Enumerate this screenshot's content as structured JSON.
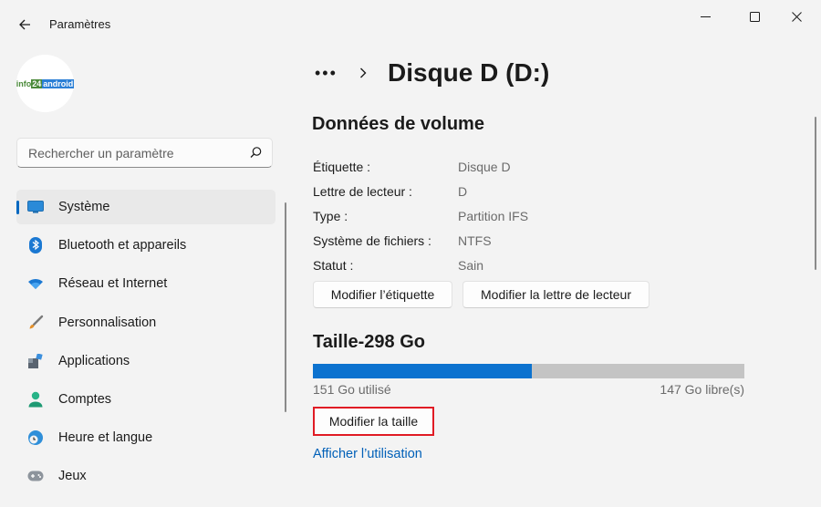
{
  "window": {
    "title": "Paramètres"
  },
  "logo": {
    "text": "info24android"
  },
  "search": {
    "placeholder": "Rechercher un paramètre"
  },
  "nav": {
    "items": [
      {
        "label": "Système",
        "icon": "monitor-icon",
        "selected": true
      },
      {
        "label": "Bluetooth et appareils",
        "icon": "bluetooth-icon"
      },
      {
        "label": "Réseau et Internet",
        "icon": "wifi-icon"
      },
      {
        "label": "Personnalisation",
        "icon": "brush-icon"
      },
      {
        "label": "Applications",
        "icon": "apps-icon"
      },
      {
        "label": "Comptes",
        "icon": "account-icon"
      },
      {
        "label": "Heure et langue",
        "icon": "globe-clock-icon"
      },
      {
        "label": "Jeux",
        "icon": "gamepad-icon"
      }
    ]
  },
  "breadcrumb": {
    "more": "•••",
    "title": "Disque D (D:)"
  },
  "volume": {
    "title": "Données de volume",
    "properties": [
      {
        "label": "Étiquette :",
        "value": "Disque D"
      },
      {
        "label": "Lettre de lecteur :",
        "value": "D"
      },
      {
        "label": "Type :",
        "value": "Partition IFS"
      },
      {
        "label": "Système de fichiers :",
        "value": "NTFS"
      },
      {
        "label": "Statut :",
        "value": "Sain"
      }
    ],
    "edit_label_button": "Modifier l’étiquette",
    "edit_letter_button": "Modifier la lettre de lecteur"
  },
  "size": {
    "title": "Taille-298 Go",
    "used_fraction": 0.507,
    "used_text": "151 Go utilisé",
    "free_text": "147 Go libre(s)",
    "resize_button": "Modifier la taille",
    "usage_link": "Afficher l’utilisation"
  },
  "colors": {
    "accent": "#0067c0",
    "bar_fill": "#0c72cf",
    "bar_track": "#c4c4c4",
    "highlight": "#e01b24"
  }
}
